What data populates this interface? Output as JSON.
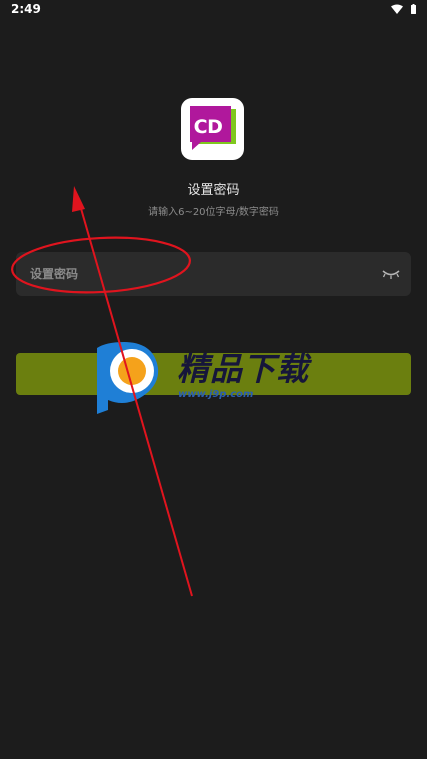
{
  "status_bar": {
    "time": "2:49",
    "icons": [
      "wifi-icon",
      "battery-icon"
    ]
  },
  "app_logo": {
    "text": "CD",
    "colors": {
      "primary": "#b0189c",
      "secondary": "#7fc81e"
    }
  },
  "header": {
    "title": "设置密码",
    "subtitle": "请输入6~20位字母/数字密码"
  },
  "password_field": {
    "placeholder": "设置密码",
    "value": "",
    "toggle_icon": "eye-closed-icon"
  },
  "confirm_button": {
    "label": "",
    "color": "#6b7f0f"
  },
  "watermark": {
    "text": "精品下载",
    "url": "www.j9p.com"
  },
  "annotation": {
    "color": "#e0141e"
  }
}
